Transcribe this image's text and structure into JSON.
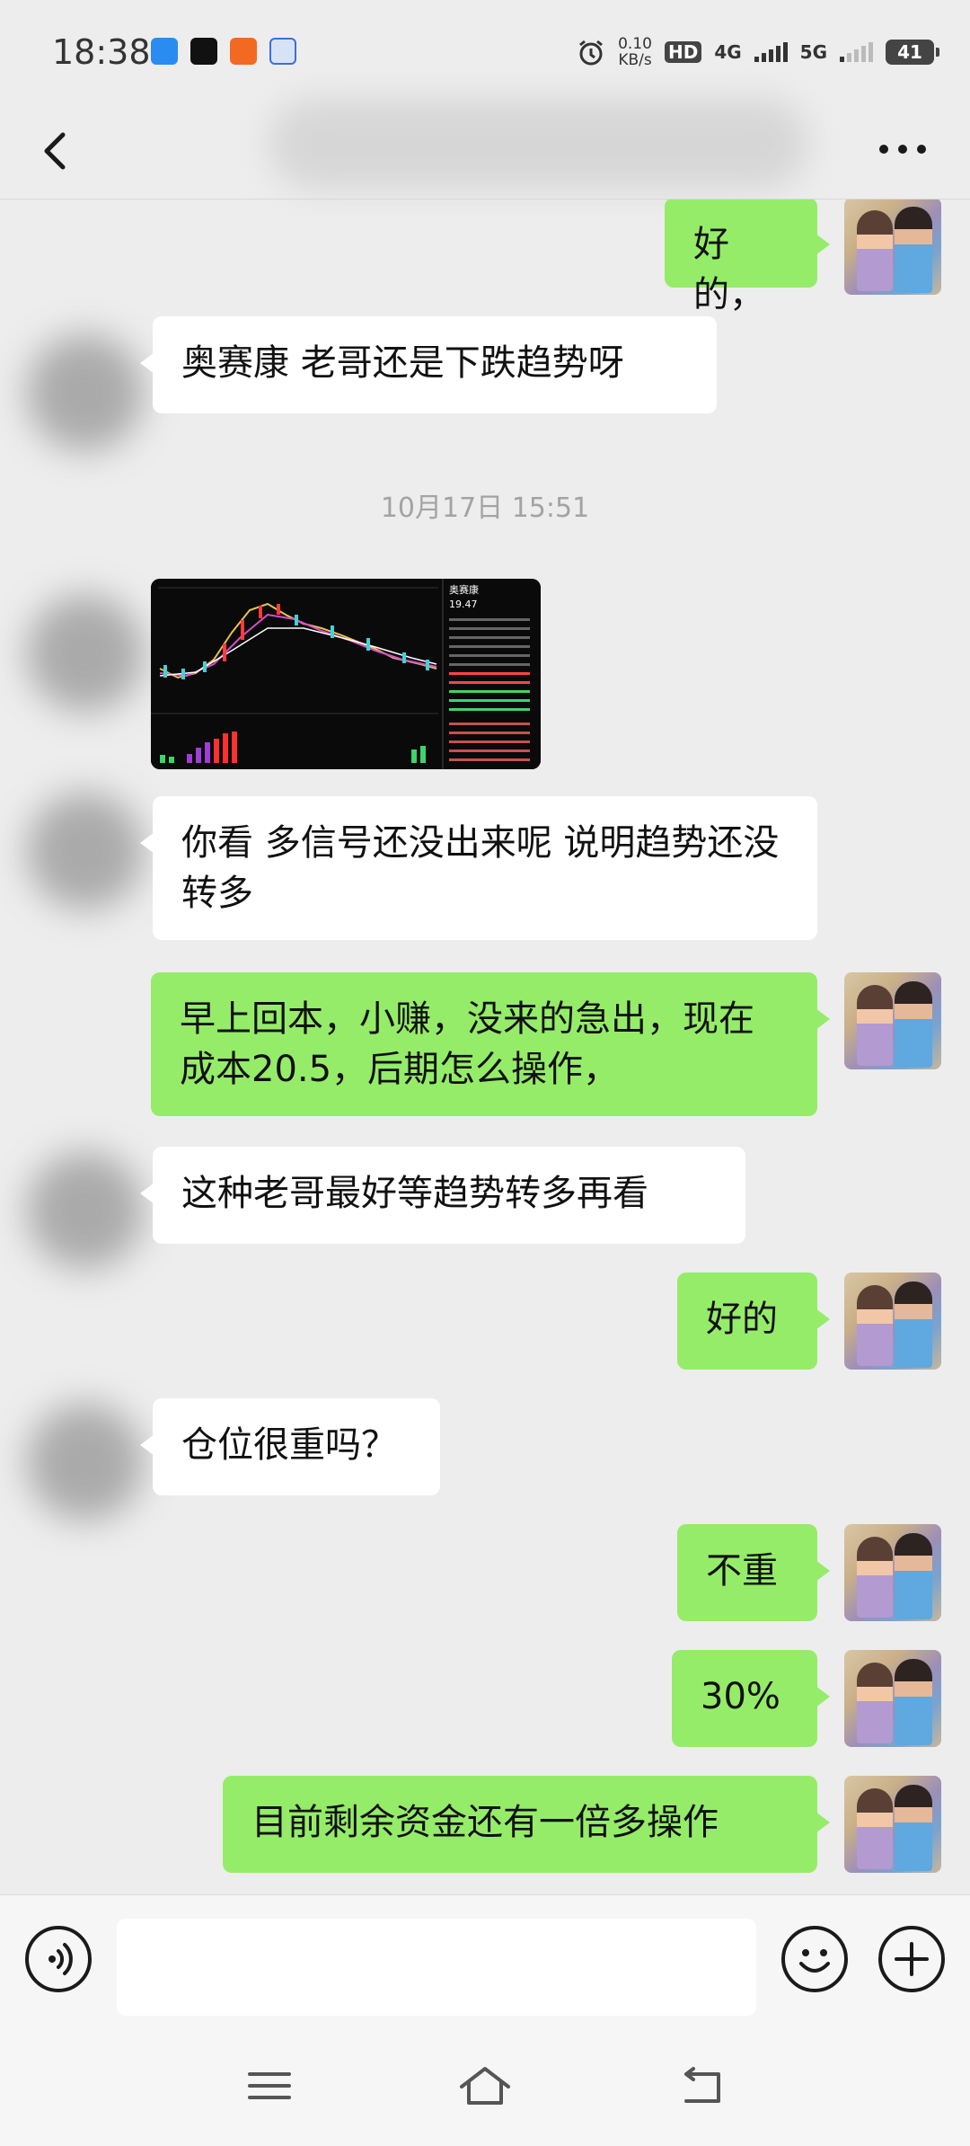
{
  "status_bar": {
    "time": "18:38",
    "network_speed_value": "0.10",
    "network_speed_unit": "KB/s",
    "hd_label": "HD",
    "sim1_label": "4G",
    "sim2_label": "5G",
    "battery": "41"
  },
  "header": {
    "back_icon": "chevron-left-icon",
    "more_icon": "more-dots-icon"
  },
  "messages": [
    {
      "side": "me",
      "text": "好的，"
    },
    {
      "side": "other",
      "text": "奥赛康 老哥还是下跌趋势呀"
    },
    {
      "side": "other",
      "type": "image",
      "image_title": "奥赛康",
      "image_price": "19.47"
    },
    {
      "side": "other",
      "text": "你看 多信号还没出来呢 说明趋势还没转多"
    },
    {
      "side": "me",
      "text": "早上回本，小赚，没来的急出，现在成本20.5，后期怎么操作，"
    },
    {
      "side": "other",
      "text": "这种老哥最好等趋势转多再看"
    },
    {
      "side": "me",
      "text": "好的"
    },
    {
      "side": "other",
      "text": "仓位很重吗？"
    },
    {
      "side": "me",
      "text": "不重"
    },
    {
      "side": "me",
      "text": "30%"
    },
    {
      "side": "me",
      "text": "目前剩余资金还有一倍多操作"
    }
  ],
  "timestamp": "10月17日 15:51",
  "input_bar": {
    "voice_icon": "voice-icon",
    "emoji_icon": "emoji-icon",
    "plus_icon": "plus-icon",
    "input_value": ""
  },
  "nav_bar": {
    "menu_icon": "menu-icon",
    "home_icon": "home-icon",
    "back_icon": "back-icon"
  },
  "colors": {
    "background": "#ededed",
    "my_bubble": "#95ec69",
    "other_bubble": "#ffffff",
    "timestamp_text": "#a3a3a3"
  }
}
